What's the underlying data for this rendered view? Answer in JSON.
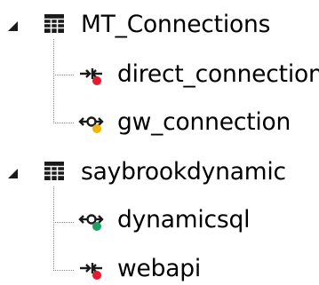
{
  "tree": {
    "groups": [
      {
        "label": "MT_Connections",
        "expanded": true,
        "icon": "database-table-icon",
        "children": [
          {
            "label": "direct_connection",
            "icon": "direct-connection-icon",
            "status_color": "#e8192c",
            "status": "error"
          },
          {
            "label": "gw_connection",
            "icon": "gateway-connection-icon",
            "status_color": "#f5b400",
            "status": "warning"
          }
        ]
      },
      {
        "label": "saybrookdynamic",
        "expanded": true,
        "icon": "database-table-icon",
        "children": [
          {
            "label": "dynamicsql",
            "icon": "gateway-connection-icon",
            "status_color": "#1aa260",
            "status": "ok"
          },
          {
            "label": "webapi",
            "icon": "direct-connection-icon",
            "status_color": "#e8192c",
            "status": "error"
          }
        ]
      }
    ],
    "colors": {
      "icon_dark": "#1a1a1a",
      "connector": "#8a8a8a",
      "error": "#e8192c",
      "warning": "#f5b400",
      "ok": "#1aa260"
    }
  }
}
